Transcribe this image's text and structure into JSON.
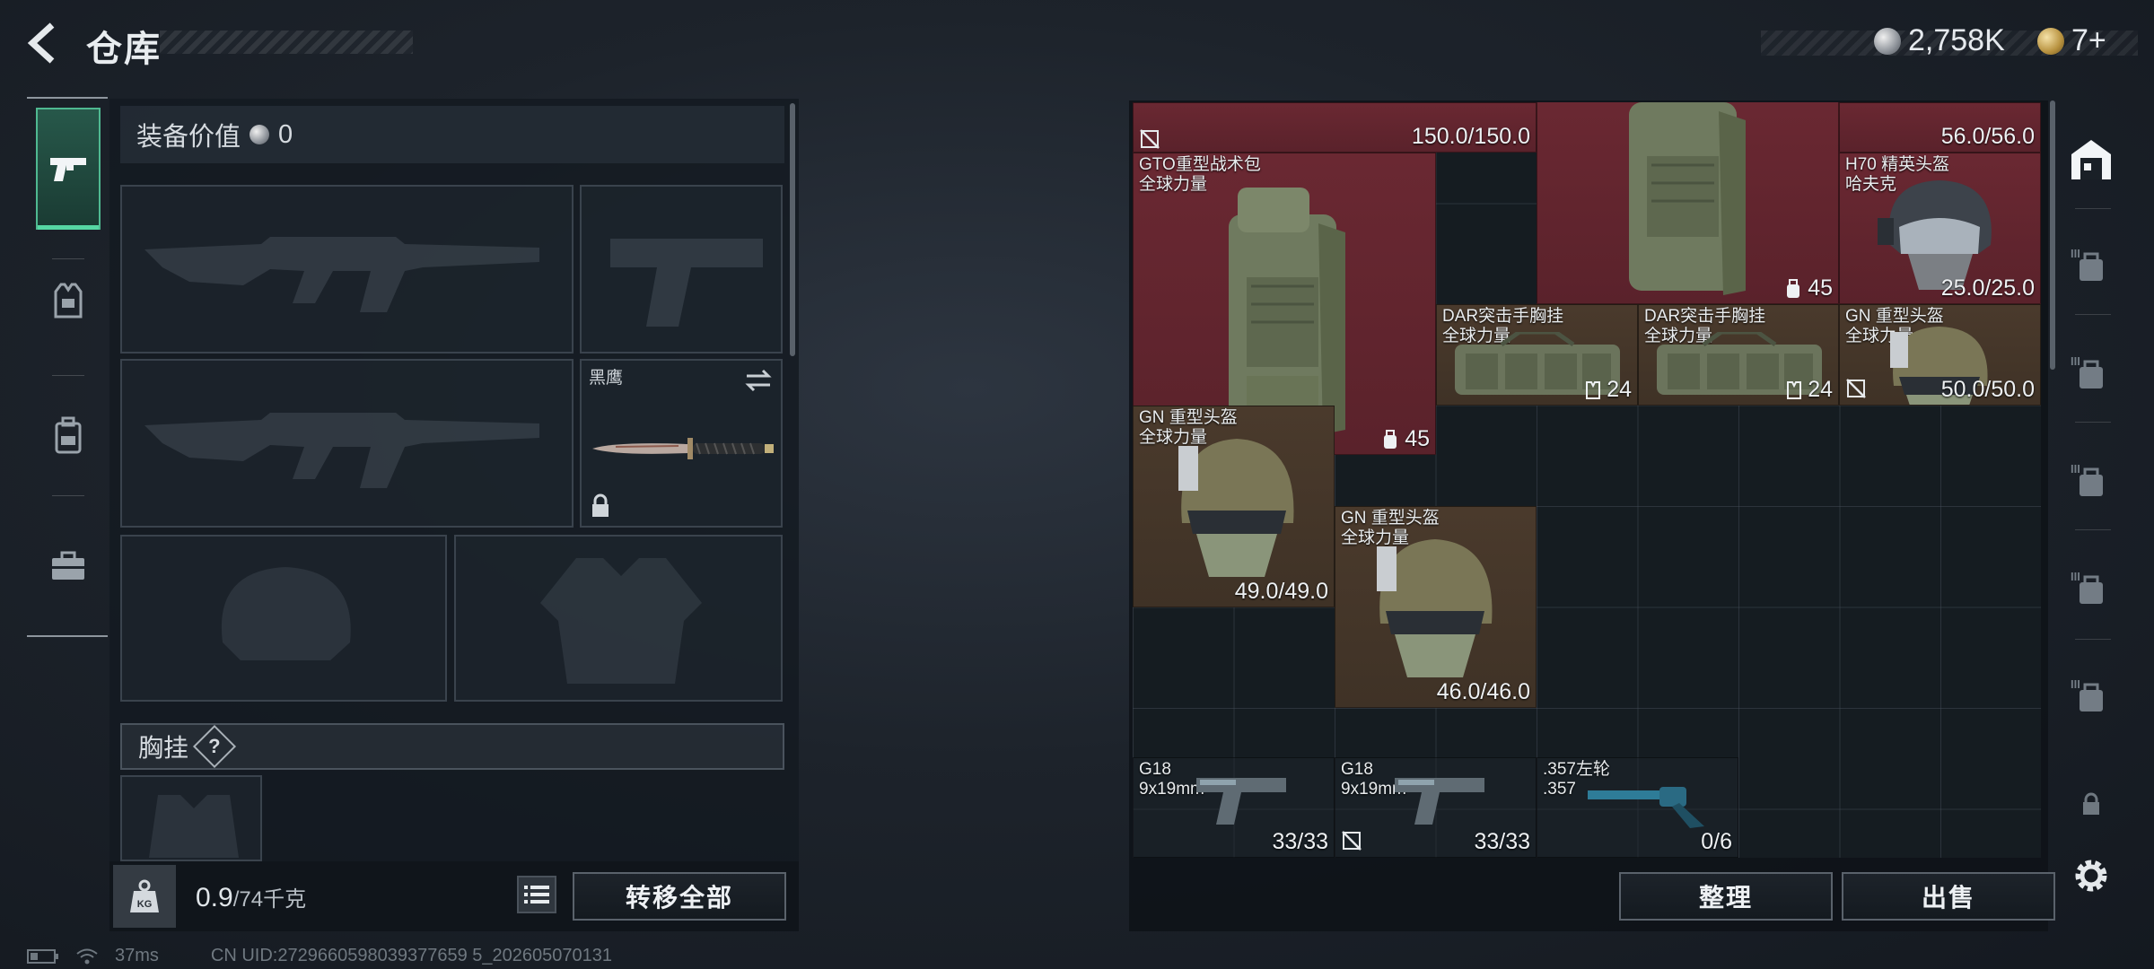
{
  "header": {
    "title": "仓库"
  },
  "currency": [
    {
      "icon": "silver-coin-icon",
      "value": "2,758K"
    },
    {
      "icon": "gold-coin-icon",
      "value": "7+"
    }
  ],
  "equipment": {
    "value_label": "装备价值",
    "value": "0",
    "knife_label": "黑鹰",
    "section_chest": "胸挂",
    "help": "?"
  },
  "bottom_left": {
    "weight_value": "0.9",
    "weight_unit": "/74千克",
    "weight_badge": "KG",
    "transfer_all": "转移全部"
  },
  "warehouse": {
    "items": [
      {
        "name": "",
        "value": "150.0/150.0"
      },
      {
        "name": "",
        "value": "56.0/56.0"
      },
      {
        "name": "GTO重型战术包\n全球力量",
        "value": "45"
      },
      {
        "name": "",
        "value": "45"
      },
      {
        "name": "H70 精英头盔\n哈夫克",
        "value": "25.0/25.0"
      },
      {
        "name": "DAR突击手胸挂\n全球力量",
        "value": "24"
      },
      {
        "name": "DAR突击手胸挂\n全球力量",
        "value": "24"
      },
      {
        "name": "GN 重型头盔\n全球力量",
        "value": "50.0/50.0"
      },
      {
        "name": "GN 重型头盔\n全球力量",
        "value": "49.0/49.0"
      },
      {
        "name": "GN 重型头盔\n全球力量",
        "value": "46.0/46.0"
      },
      {
        "name": "G18\n9x19mm",
        "value": "33/33"
      },
      {
        "name": "G18\n9x19mm",
        "value": "33/33"
      },
      {
        "name": ".357左轮\n.357",
        "value": "0/6"
      }
    ],
    "sort_label": "整理",
    "sell_label": "出售"
  },
  "status": {
    "ping": "37ms",
    "uid": "CN UID:2729660598039377659 5_202605070131"
  },
  "colors": {
    "accent": "#4fb991",
    "red_item": "#5e232d",
    "brown_item": "#433528"
  }
}
